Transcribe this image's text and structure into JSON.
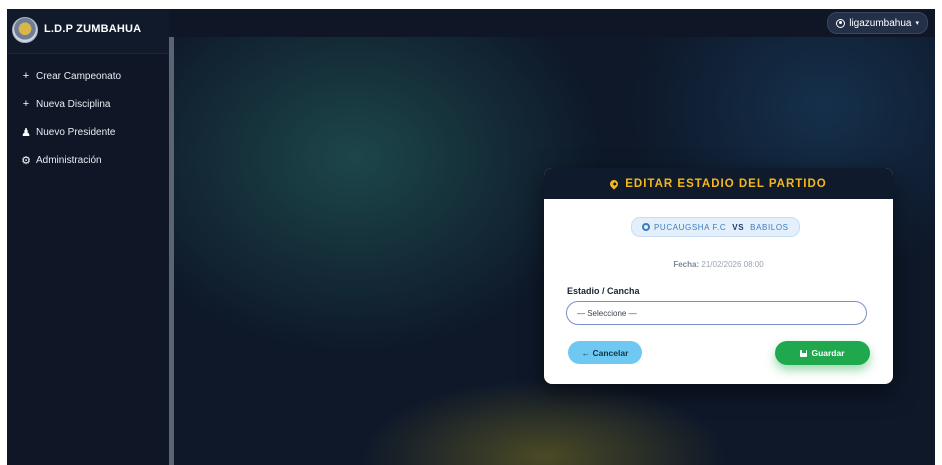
{
  "brand": {
    "title": "L.D.P ZUMBAHUA"
  },
  "user": {
    "name": "ligazumbahua"
  },
  "sidebar": {
    "items": [
      {
        "icon": "+",
        "label": "Crear Campeonato"
      },
      {
        "icon": "+",
        "label": "Nueva Disciplina"
      },
      {
        "icon": "user-icon",
        "label": "Nuevo Presidente"
      },
      {
        "icon": "cogs-icon",
        "label": "Administración"
      }
    ]
  },
  "modal": {
    "title": "EDITAR ESTADIO DEL PARTIDO",
    "home_team": "PUCAUGSHA F.C",
    "vs": "VS",
    "away_team": "BABILOS",
    "date_label": "Fecha:",
    "date_value": "21/02/2026 08:00",
    "field_label": "Estadio / Cancha",
    "select_value": "— Seleccione —",
    "cancel_label": "← Cancelar",
    "save_label": "Guardar"
  },
  "colors": {
    "accent": "#f4b81d",
    "save": "#1fa84e",
    "cancel": "#6ec8f2"
  }
}
